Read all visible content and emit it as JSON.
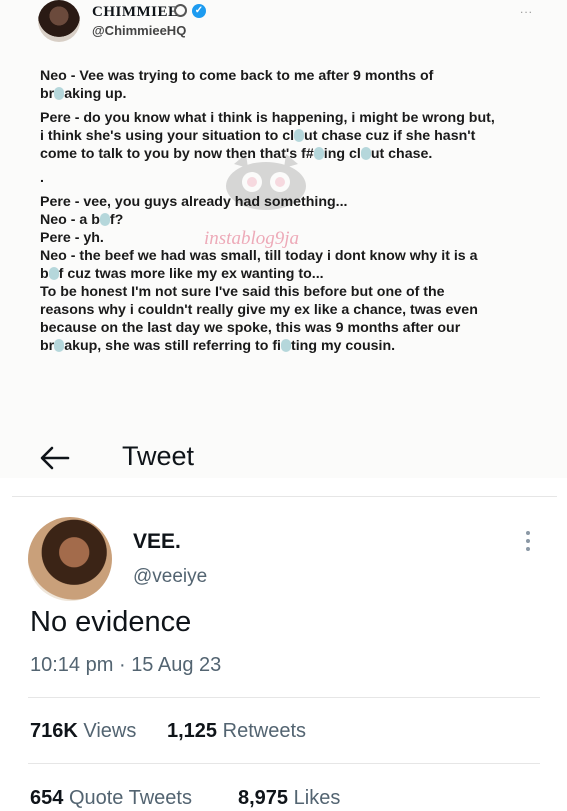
{
  "screenshot_tweet": {
    "author_name": "CHIMMIEE",
    "author_handle": "@ChimmieeHQ",
    "more_label": "...",
    "verified_check": "✓",
    "watermark": "instablog9ja",
    "paragraphs": [
      [
        "Neo - Vee was trying to come back to me after 9 months of",
        "br{b}aking up."
      ],
      [
        "Pere - do you know what i think is happening, i might be wrong but,",
        "i think she's using your situation to cl{b}ut chase cuz if she hasn't",
        "come to talk to you by now then that's f#{b}ing cl{b}ut chase."
      ],
      [
        "."
      ],
      [
        "Pere - vee, you guys already had something...",
        "Neo - a b{b}f?",
        "Pere - yh.",
        "Neo - the beef we had was small, till today i dont know why it is a",
        "b{b}f cuz twas more like my ex wanting to...",
        "To be honest I'm not sure I've said this before but one of the",
        "reasons why i couldn't really give my ex like a chance, twas even",
        "because on the last day we spoke, this was 9 months after our",
        "br{b}akup, she was still referring to fi{b}ting my cousin."
      ]
    ]
  },
  "header": {
    "back_icon": "arrow-left-icon",
    "title": "Tweet"
  },
  "tweet": {
    "author_name": "VEE.",
    "author_handle": "@veeiye",
    "more_icon": "vertical-dots-icon",
    "text": "No evidence",
    "time": "10:14 pm",
    "separator": "·",
    "date": "15 Aug 23",
    "views_count": "716K",
    "views_label": "Views",
    "retweets_count": "1,125",
    "retweets_label": "Retweets",
    "quotes_count": "654",
    "quotes_label": "Quote Tweets",
    "likes_count": "8,975",
    "likes_label": "Likes"
  }
}
